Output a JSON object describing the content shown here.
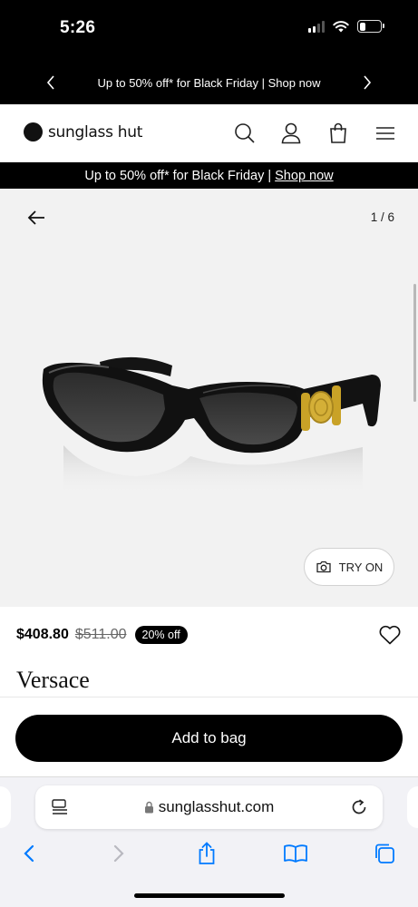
{
  "status_bar": {
    "time": "5:26",
    "battery_level": 0.3
  },
  "top_promo": {
    "text": "Up to 50% off* for Black Friday | Shop now"
  },
  "header": {
    "logo_text": "sunglass hut"
  },
  "promo_bar": {
    "text": "Up to 50% off* for Black Friday |",
    "link": "Shop now"
  },
  "gallery": {
    "counter": "1 / 6",
    "try_on_label": "TRY ON"
  },
  "product": {
    "price": "$408.80",
    "original_price": "$511.00",
    "discount": "20% off",
    "brand": "Versace"
  },
  "cta": {
    "add_to_bag": "Add to bag"
  },
  "browser": {
    "url": "sunglasshut.com"
  },
  "colors": {
    "accent": "#000000",
    "link_blue": "#007aff",
    "gallery_bg": "#f2f2f2"
  }
}
